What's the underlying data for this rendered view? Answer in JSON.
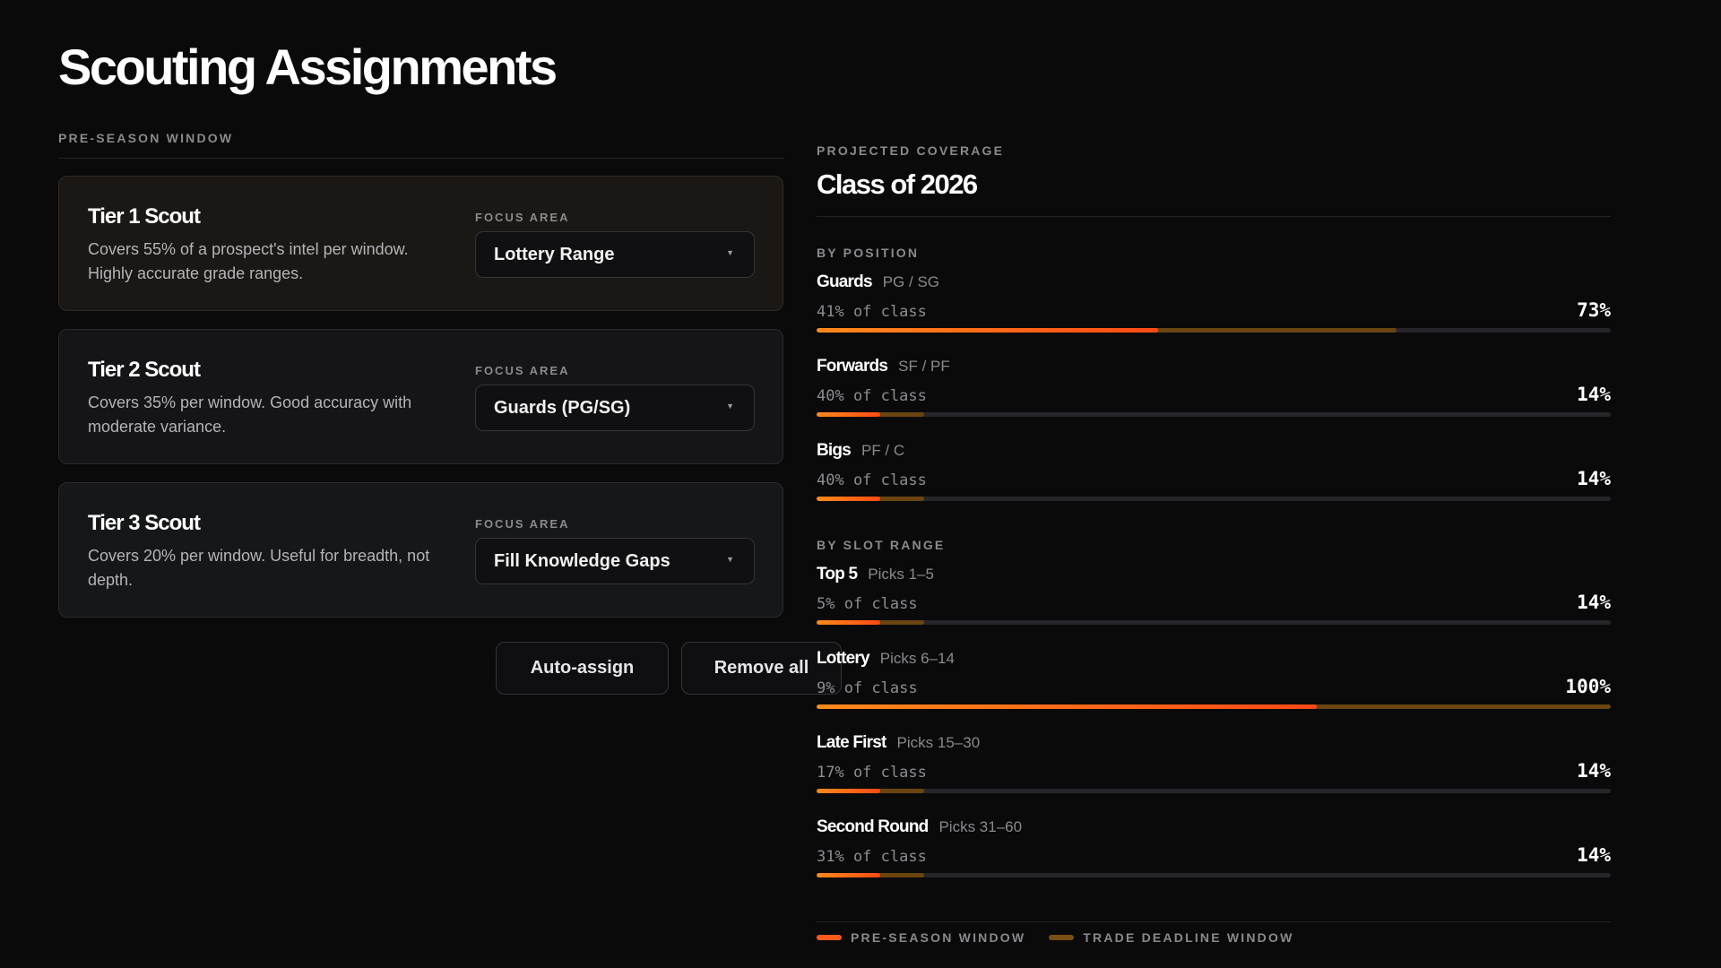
{
  "page": {
    "title": "Scouting Assignments"
  },
  "left": {
    "section_label": "PRE-SEASON WINDOW",
    "focus_label": "FOCUS AREA",
    "cards": [
      {
        "title": "Tier 1 Scout",
        "desc": "Covers 55% of a prospect's intel per window. Highly accurate grade ranges.",
        "focus_value": "Lottery Range"
      },
      {
        "title": "Tier 2 Scout",
        "desc": "Covers 35% per window. Good accuracy with moderate variance.",
        "focus_value": "Guards (PG/SG)"
      },
      {
        "title": "Tier 3 Scout",
        "desc": "Covers 20% per window. Useful for breadth, not depth.",
        "focus_value": "Fill Knowledge Gaps"
      }
    ],
    "actions": {
      "auto_assign": "Auto-assign",
      "remove_all": "Remove all"
    }
  },
  "right": {
    "eyebrow": "PROJECTED COVERAGE",
    "title": "Class of 2026",
    "by_position_label": "BY POSITION",
    "by_slot_label": "BY SLOT RANGE",
    "positions": [
      {
        "name": "Guards",
        "sub": "PG / SG",
        "share": "41% of class",
        "pct_label": "73%",
        "pre_season": 0.43,
        "trade_deadline": 0.73
      },
      {
        "name": "Forwards",
        "sub": "SF / PF",
        "share": "40% of class",
        "pct_label": "14%",
        "pre_season": 0.08,
        "trade_deadline": 0.135
      },
      {
        "name": "Bigs",
        "sub": "PF / C",
        "share": "40% of class",
        "pct_label": "14%",
        "pre_season": 0.08,
        "trade_deadline": 0.135
      }
    ],
    "slots": [
      {
        "name": "Top 5",
        "sub": "Picks 1–5",
        "share": "5% of class",
        "pct_label": "14%",
        "pre_season": 0.08,
        "trade_deadline": 0.135
      },
      {
        "name": "Lottery",
        "sub": "Picks 6–14",
        "share": "9% of class",
        "pct_label": "100%",
        "pre_season": 0.63,
        "trade_deadline": 1.0
      },
      {
        "name": "Late First",
        "sub": "Picks 15–30",
        "share": "17% of class",
        "pct_label": "14%",
        "pre_season": 0.08,
        "trade_deadline": 0.135
      },
      {
        "name": "Second Round",
        "sub": "Picks 31–60",
        "share": "31% of class",
        "pct_label": "14%",
        "pre_season": 0.08,
        "trade_deadline": 0.135
      }
    ],
    "legend": [
      {
        "label": "PRE-SEASON WINDOW",
        "color": "#ff5a1a"
      },
      {
        "label": "TRADE DEADLINE WINDOW",
        "color": "#7a4e12"
      }
    ]
  }
}
